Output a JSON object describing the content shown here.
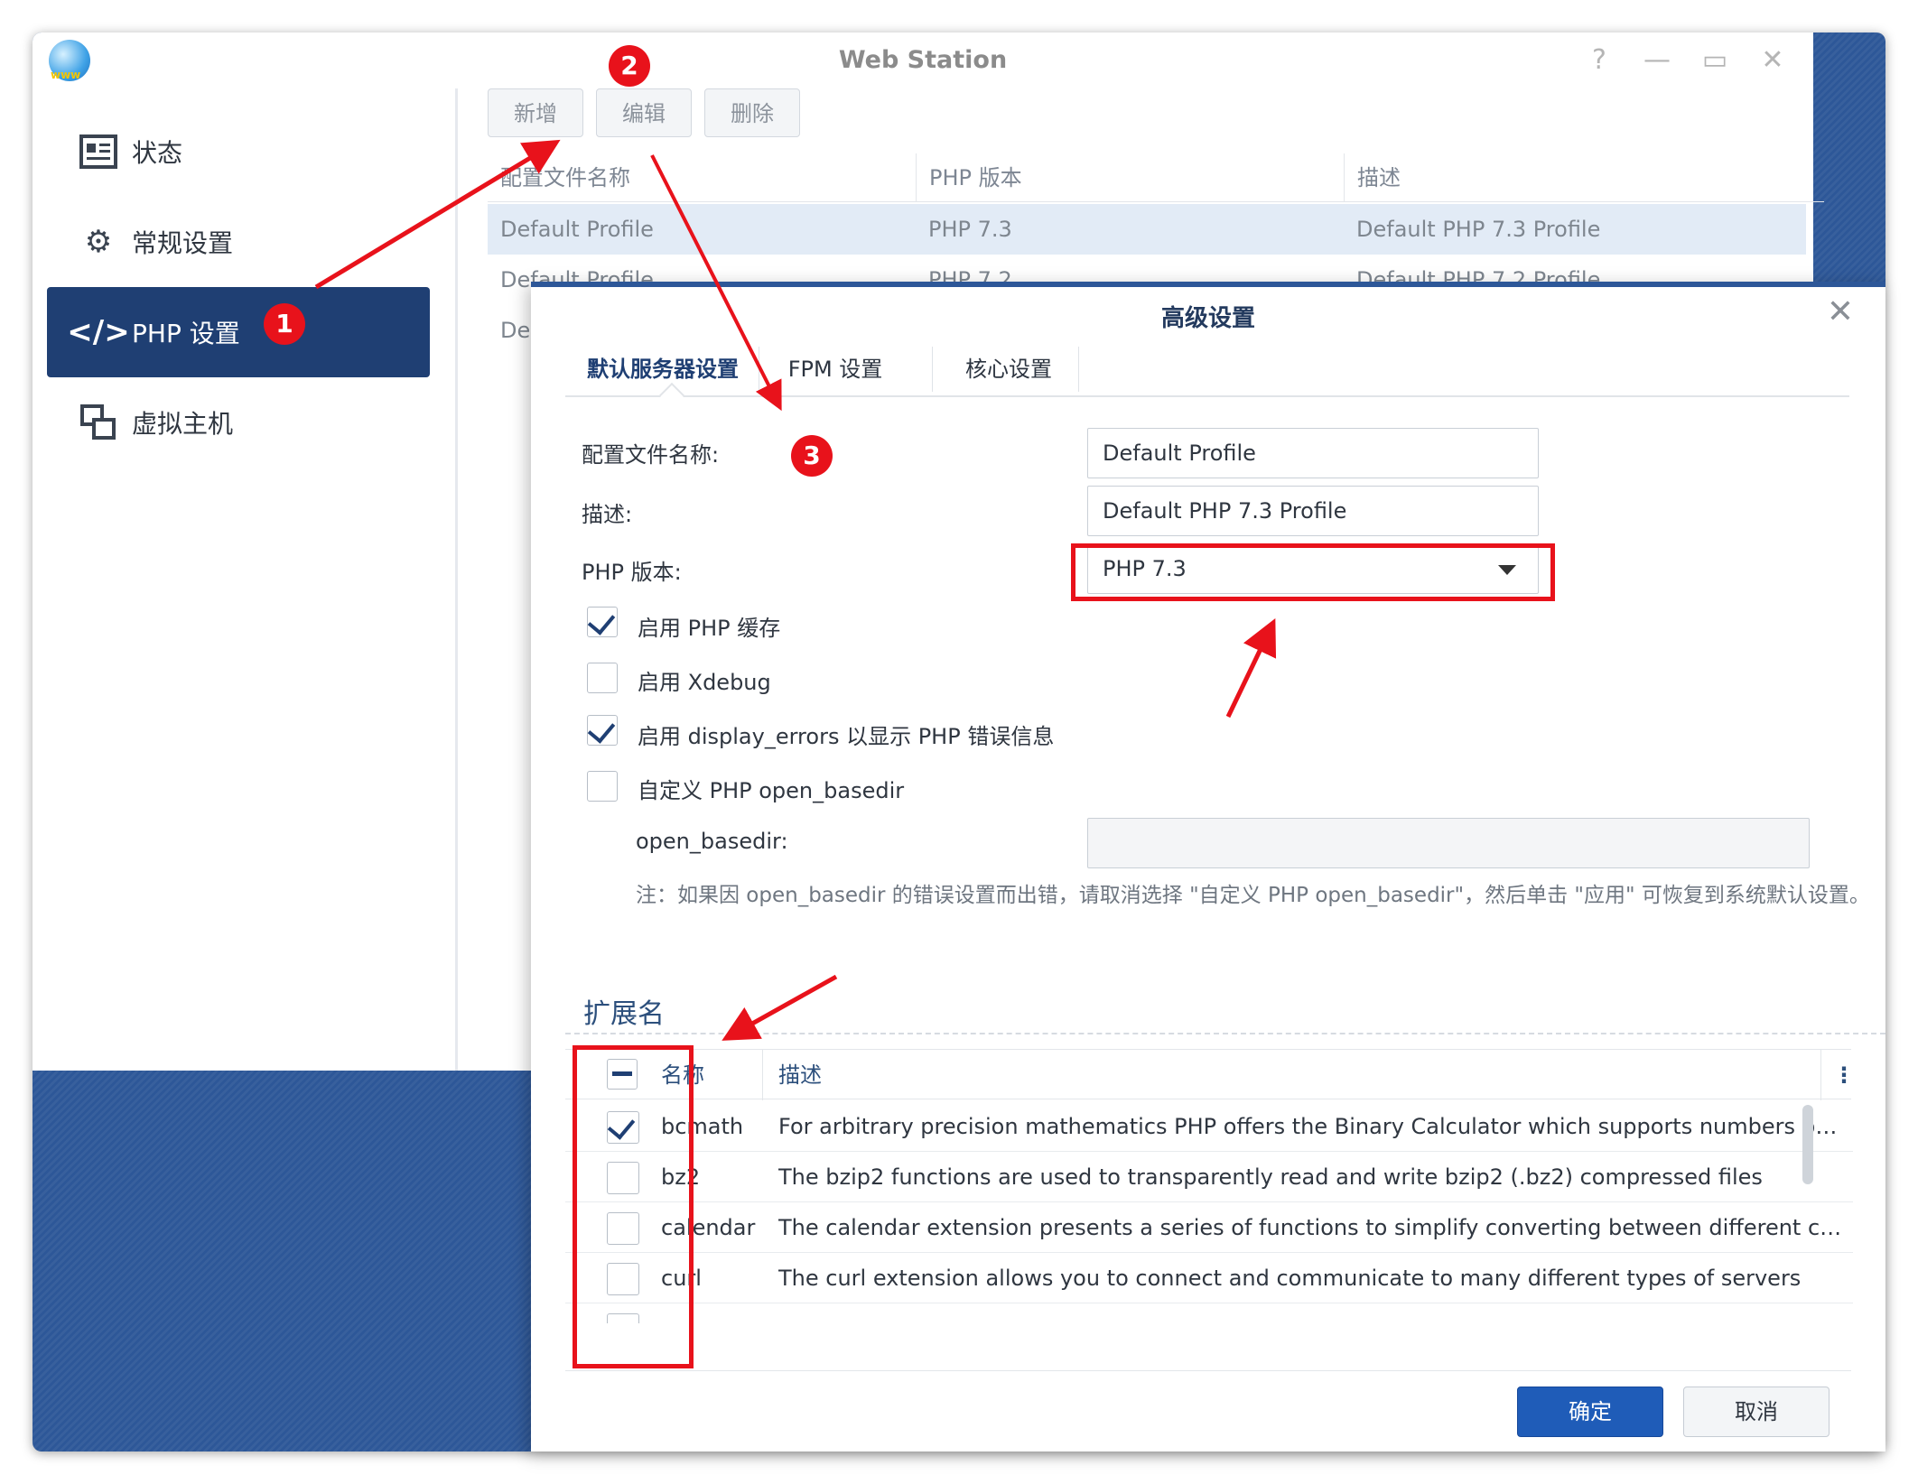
{
  "window": {
    "title": "Web Station"
  },
  "sidebar": {
    "items": [
      {
        "label": "状态",
        "icon": "status-card-icon"
      },
      {
        "label": "常规设置",
        "icon": "gear-icon"
      },
      {
        "label": "PHP 设置",
        "icon": "code-brackets-icon",
        "active": true
      },
      {
        "label": "虚拟主机",
        "icon": "virtual-host-icon"
      }
    ]
  },
  "toolbar": {
    "add_label": "新增",
    "edit_label": "编辑",
    "delete_label": "删除"
  },
  "profile_list": {
    "columns": [
      "配置文件名称",
      "PHP 版本",
      "描述"
    ],
    "rows": [
      {
        "name": "Default Profile",
        "version": "PHP 7.3",
        "desc": "Default PHP 7.3 Profile"
      },
      {
        "name": "Default Profile",
        "version": "PHP 7.2",
        "desc": "Default PHP 7.2 Profile"
      },
      {
        "name": "De",
        "version": "",
        "desc": ""
      }
    ]
  },
  "dialog": {
    "title": "高级设置",
    "tabs": [
      "默认服务器设置",
      "FPM 设置",
      "核心设置"
    ],
    "fields": {
      "profile_name_label": "配置文件名称:",
      "profile_name_value": "Default Profile",
      "desc_label": "描述:",
      "desc_value": "Default PHP 7.3 Profile",
      "php_version_label": "PHP 版本:",
      "php_version_value": "PHP 7.3"
    },
    "options": [
      {
        "label": "启用 PHP 缓存",
        "checked": true
      },
      {
        "label": "启用 Xdebug",
        "checked": false
      },
      {
        "label": "启用 display_errors 以显示 PHP 错误信息",
        "checked": true
      },
      {
        "label": "自定义 PHP open_basedir",
        "checked": false
      }
    ],
    "open_basedir_label": "open_basedir:",
    "note": "注：如果因 open_basedir 的错误设置而出错，请取消选择 \"自定义 PHP open_basedir\"，然后单击 \"应用\" 可恢复到系统默认设置。",
    "extensions": {
      "title": "扩展名",
      "columns": {
        "name": "名称",
        "desc": "描述"
      },
      "rows": [
        {
          "name": "bcmath",
          "desc": "For arbitrary precision mathematics PHP offers the Binary Calculator which supports numbers of any size and precision",
          "checked": true
        },
        {
          "name": "bz2",
          "desc": "The bzip2 functions are used to transparently read and write bzip2 (.bz2) compressed files",
          "checked": false
        },
        {
          "name": "calendar",
          "desc": "The calendar extension presents a series of functions to simplify converting between different calendar formats",
          "checked": false
        },
        {
          "name": "curl",
          "desc": "The curl extension allows you to connect and communicate to many different types of servers",
          "checked": false
        }
      ]
    },
    "ok_label": "确定",
    "cancel_label": "取消"
  },
  "annotations": {
    "badges": [
      "1",
      "2",
      "3"
    ],
    "color": "#e8121b"
  },
  "colors": {
    "accent": "#1f3f73",
    "desktop": "#2d5798",
    "primary_button": "#1f5cb8"
  }
}
